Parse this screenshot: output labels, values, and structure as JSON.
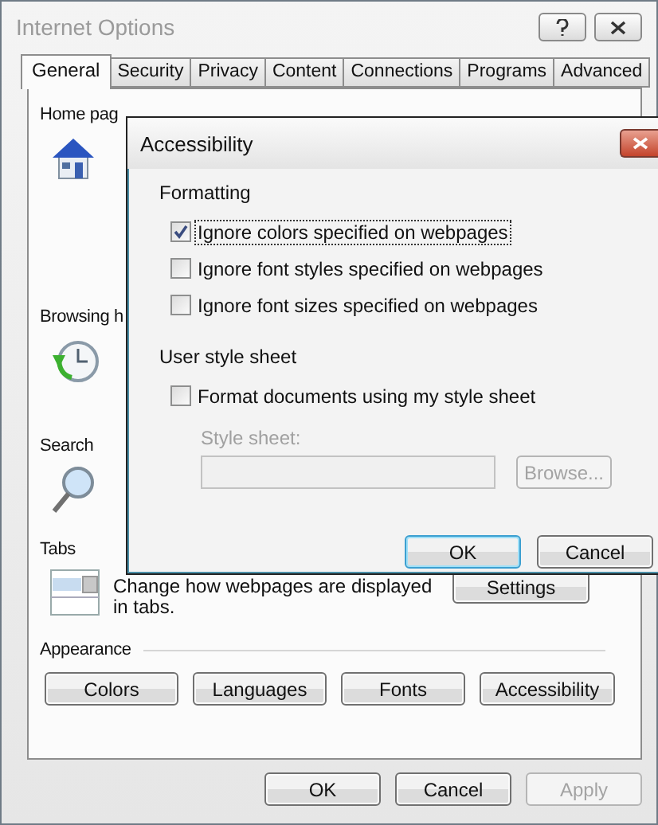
{
  "window": {
    "title": "Internet Options"
  },
  "tabs": [
    {
      "label": "General",
      "selected": true
    },
    {
      "label": "Security",
      "selected": false
    },
    {
      "label": "Privacy",
      "selected": false
    },
    {
      "label": "Content",
      "selected": false
    },
    {
      "label": "Connections",
      "selected": false
    },
    {
      "label": "Programs",
      "selected": false
    },
    {
      "label": "Advanced",
      "selected": false
    }
  ],
  "sections": [
    {
      "kind": "home",
      "label": "Home pag"
    },
    {
      "kind": "history",
      "label": "Browsing h"
    },
    {
      "kind": "search",
      "label": "Search"
    },
    {
      "kind": "tabs",
      "label": "Tabs",
      "description": "Change how webpages are displayed in tabs.",
      "button": "Settings"
    }
  ],
  "appearance": {
    "label": "Appearance",
    "buttons": [
      "Colors",
      "Languages",
      "Fonts",
      "Accessibility"
    ]
  },
  "footer_buttons": [
    {
      "label": "OK",
      "disabled": false
    },
    {
      "label": "Cancel",
      "disabled": false
    },
    {
      "label": "Apply",
      "disabled": true
    }
  ],
  "dialog": {
    "title": "Accessibility",
    "formatting": {
      "label": "Formatting",
      "options": [
        {
          "label": "Ignore colors specified on webpages",
          "checked": true,
          "focused": true
        },
        {
          "label": "Ignore font styles specified on webpages",
          "checked": false,
          "focused": false
        },
        {
          "label": "Ignore font sizes specified on webpages",
          "checked": false,
          "focused": false
        }
      ]
    },
    "style_sheet": {
      "label": "User style sheet",
      "option": {
        "label": "Format documents using my style sheet",
        "checked": false
      },
      "field_label": "Style sheet:",
      "browse": "Browse...",
      "disabled": true
    },
    "buttons": [
      {
        "label": "OK",
        "default": true
      },
      {
        "label": "Cancel",
        "default": false
      }
    ]
  }
}
